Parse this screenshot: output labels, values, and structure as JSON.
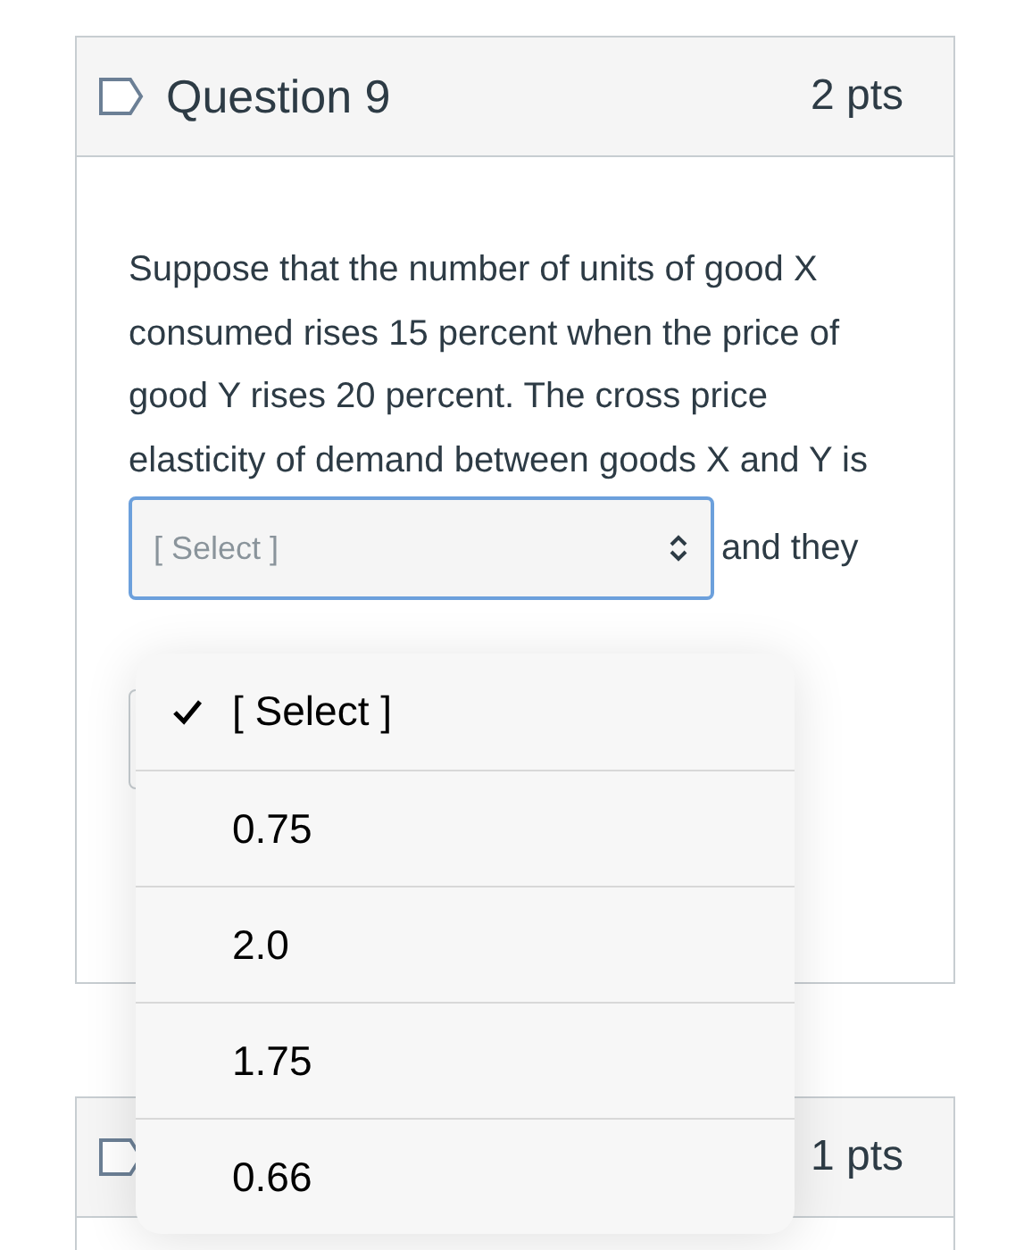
{
  "question": {
    "title": "Question 9",
    "points": "2 pts",
    "text_before": "Suppose that the number of units of good X consumed rises 15 percent when the price of good Y rises 20 percent. The cross price elasticity of demand between goods X and Y is",
    "select": {
      "value": "[ Select ]"
    },
    "text_after": "and they"
  },
  "next_question": {
    "points": "1 pts"
  },
  "menu": {
    "options": [
      {
        "label": "[ Select ]",
        "selected": true
      },
      {
        "label": "0.75",
        "selected": false
      },
      {
        "label": "2.0",
        "selected": false
      },
      {
        "label": "1.75",
        "selected": false
      },
      {
        "label": "0.66",
        "selected": false
      }
    ]
  }
}
